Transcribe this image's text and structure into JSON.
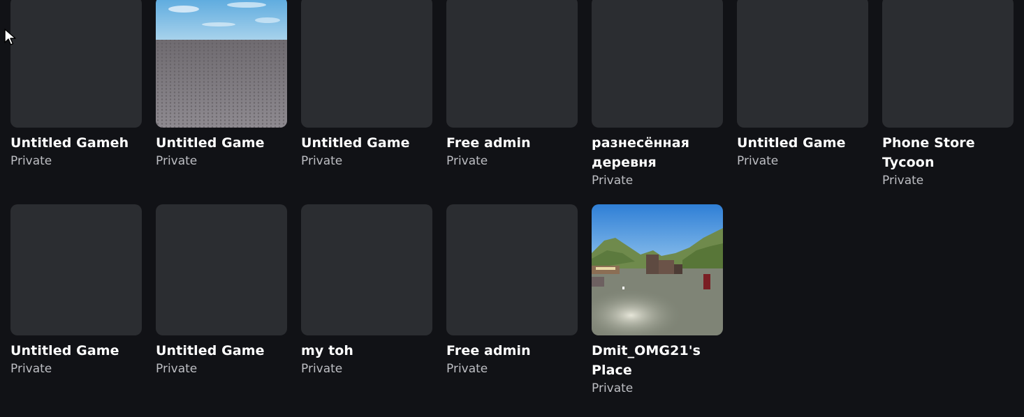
{
  "colors": {
    "page_background": "#111216",
    "card_placeholder": "#2b2d31",
    "title_text": "#ffffff",
    "status_text": "#bdbec3"
  },
  "games": [
    {
      "title": "Untitled Gameh",
      "status": "Private",
      "thumbnail": "placeholder"
    },
    {
      "title": "Untitled Game",
      "status": "Private",
      "thumbnail": "baseplate-sky"
    },
    {
      "title": "Untitled Game",
      "status": "Private",
      "thumbnail": "placeholder"
    },
    {
      "title": "Free admin",
      "status": "Private",
      "thumbnail": "placeholder"
    },
    {
      "title": "разнесённая деревня",
      "status": "Private",
      "thumbnail": "placeholder"
    },
    {
      "title": "Untitled Game",
      "status": "Private",
      "thumbnail": "placeholder"
    },
    {
      "title": "Phone Store Tycoon",
      "status": "Private",
      "thumbnail": "placeholder"
    },
    {
      "title": "Untitled Game",
      "status": "Private",
      "thumbnail": "placeholder"
    },
    {
      "title": "Untitled Game",
      "status": "Private",
      "thumbnail": "placeholder"
    },
    {
      "title": "my toh",
      "status": "Private",
      "thumbnail": "placeholder"
    },
    {
      "title": "Free admin",
      "status": "Private",
      "thumbnail": "placeholder"
    },
    {
      "title": "Dmit_OMG21's Place",
      "status": "Private",
      "thumbnail": "mountain-village"
    }
  ],
  "cursor_icon": "mouse-pointer-icon"
}
